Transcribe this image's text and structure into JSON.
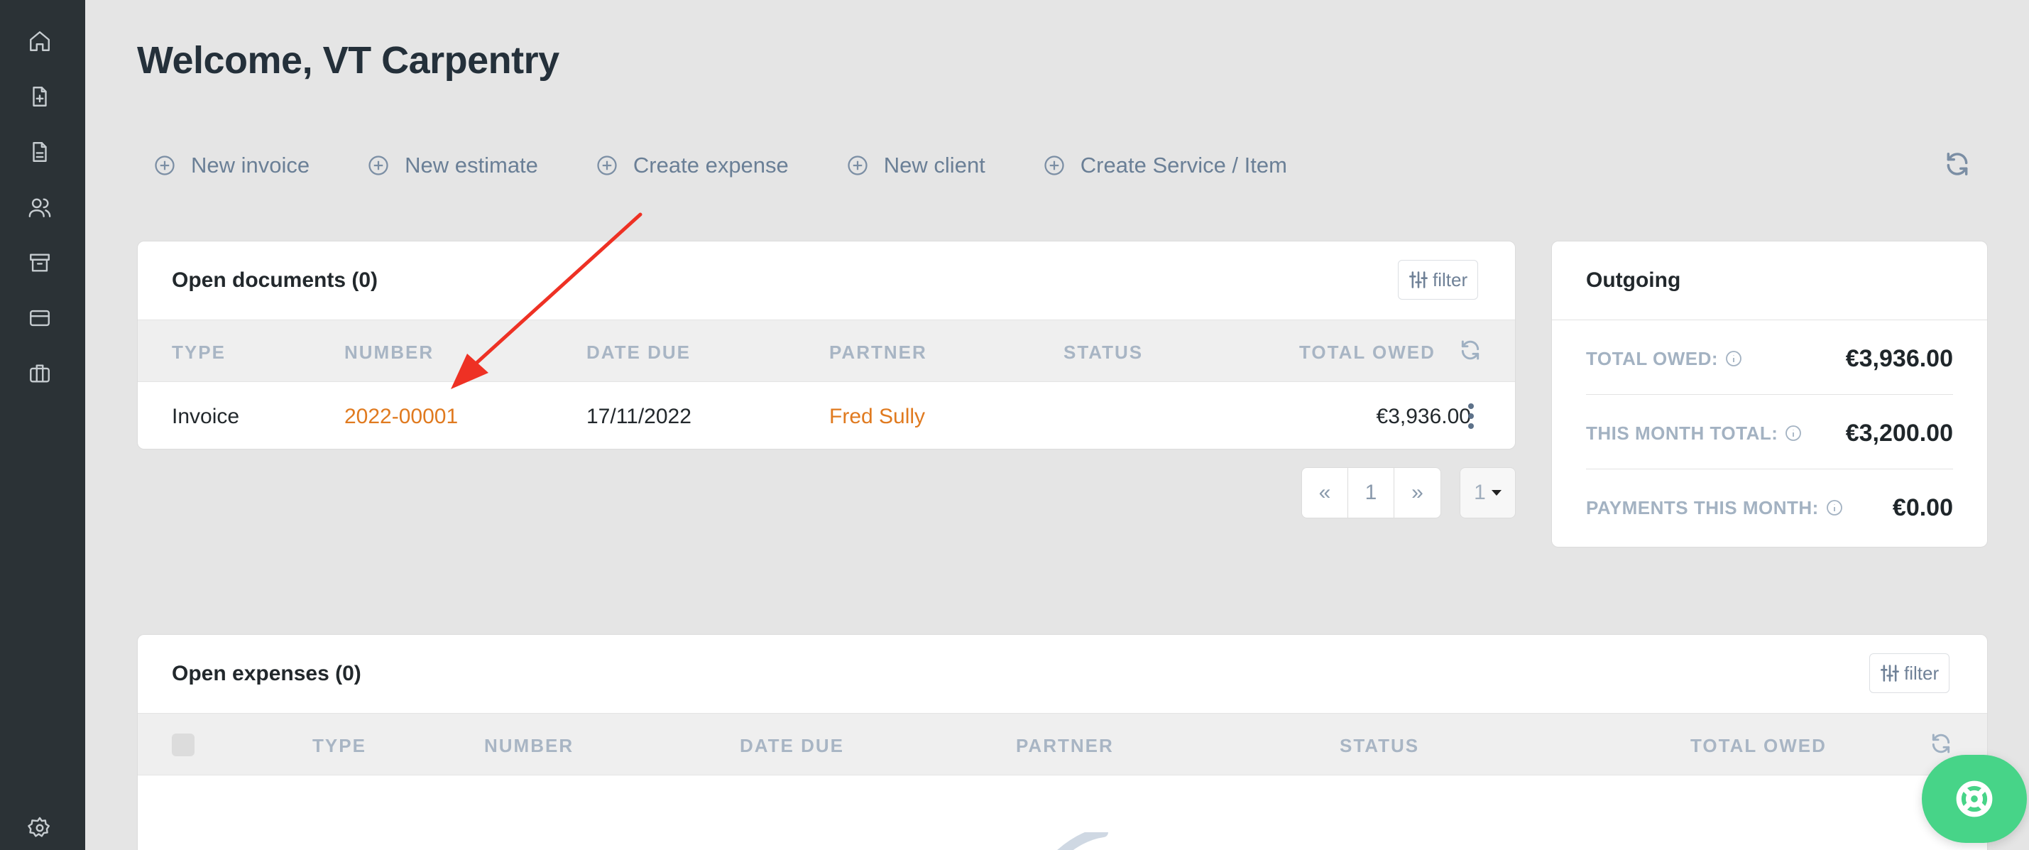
{
  "page": {
    "title": "Welcome, VT Carpentry"
  },
  "sidebar": {
    "items": [
      {
        "icon": "home-icon"
      },
      {
        "icon": "invoice-add-icon"
      },
      {
        "icon": "document-icon"
      },
      {
        "icon": "users-icon"
      },
      {
        "icon": "archive-icon"
      },
      {
        "icon": "credit-card-icon"
      },
      {
        "icon": "briefcase-icon"
      },
      {
        "icon": "gear-icon"
      }
    ]
  },
  "actions": [
    {
      "label": "New invoice"
    },
    {
      "label": "New estimate"
    },
    {
      "label": "Create expense"
    },
    {
      "label": "New client"
    },
    {
      "label": "Create Service / Item"
    }
  ],
  "open_documents": {
    "title": "Open documents (0)",
    "filter_label": "filter",
    "columns": [
      "TYPE",
      "NUMBER",
      "DATE DUE",
      "PARTNER",
      "STATUS",
      "TOTAL OWED"
    ],
    "rows": [
      {
        "type": "Invoice",
        "number": "2022-00001",
        "date_due": "17/11/2022",
        "partner": "Fred Sully",
        "status": "",
        "total_owed": "€3,936.00"
      }
    ],
    "pagination": {
      "prev": "«",
      "page": "1",
      "next": "»",
      "page_size": "1"
    }
  },
  "outgoing": {
    "title": "Outgoing",
    "items": [
      {
        "label": "TOTAL OWED:",
        "value": "€3,936.00"
      },
      {
        "label": "THIS MONTH TOTAL:",
        "value": "€3,200.00"
      },
      {
        "label": "PAYMENTS THIS MONTH:",
        "value": "€0.00"
      }
    ]
  },
  "open_expenses": {
    "title": "Open expenses (0)",
    "filter_label": "filter",
    "columns": [
      "TYPE",
      "NUMBER",
      "DATE DUE",
      "PARTNER",
      "STATUS",
      "TOTAL OWED"
    ]
  },
  "colors": {
    "sidebar": "#2b3236",
    "accent": "#e07a1f",
    "help_button": "#47d488",
    "annotation_arrow": "#ee3124"
  }
}
